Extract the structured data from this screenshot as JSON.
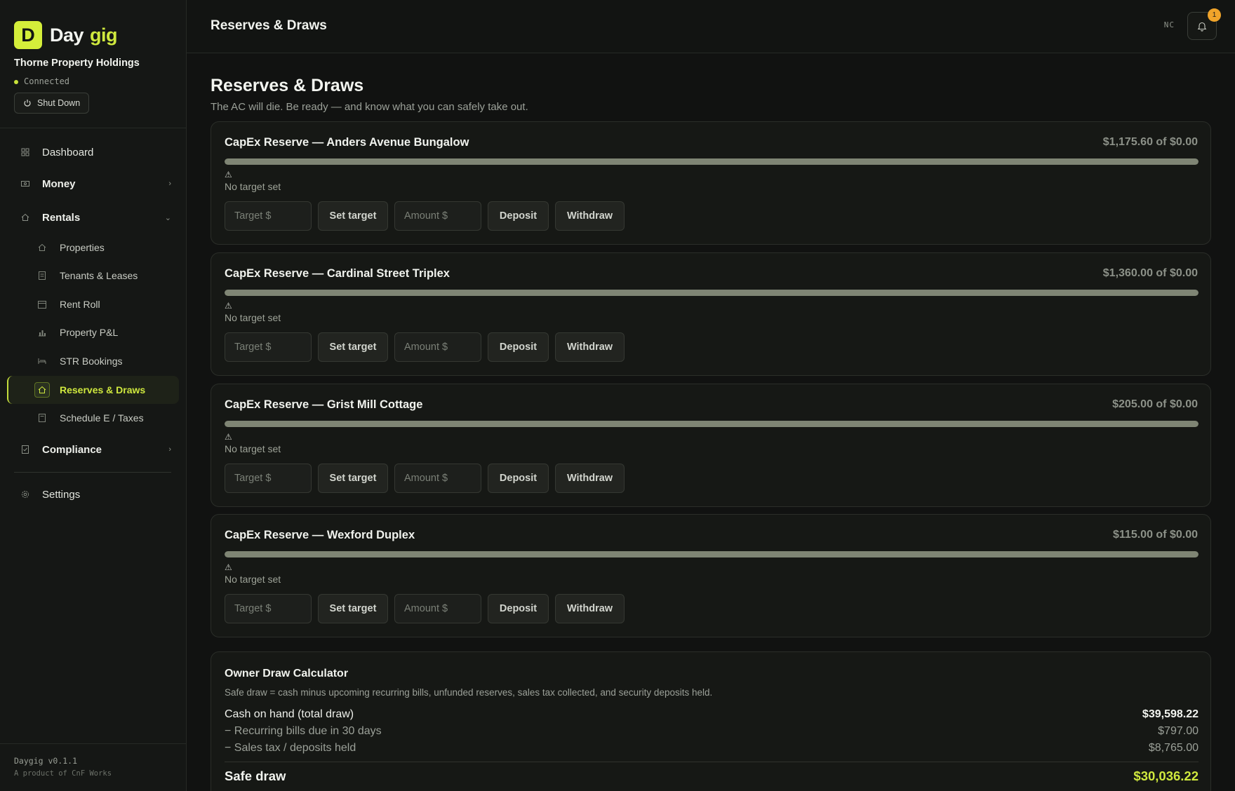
{
  "brand": {
    "logo_letter": "D",
    "name_part1": "Day",
    "name_part2": "gig",
    "accent": "#d4ee3a"
  },
  "org": {
    "name": "Thorne Property Holdings",
    "status": "Connected",
    "shutdown_label": "Shut Down"
  },
  "nav": {
    "dashboard": "Dashboard",
    "money": "Money",
    "rentals": "Rentals",
    "sub": [
      {
        "label": "Properties",
        "icon": "home-icon"
      },
      {
        "label": "Tenants & Leases",
        "icon": "document-icon"
      },
      {
        "label": "Rent Roll",
        "icon": "calendar-icon"
      },
      {
        "label": "Property P&L",
        "icon": "chart-icon"
      },
      {
        "label": "STR Bookings",
        "icon": "bed-icon"
      },
      {
        "label": "Reserves & Draws",
        "icon": "piggy-bank-icon",
        "active": true
      },
      {
        "label": "Schedule E / Taxes",
        "icon": "form-icon"
      }
    ],
    "compliance": "Compliance",
    "settings": "Settings"
  },
  "footer": {
    "version": "Daygig v0.1.1",
    "byline": "A product of CnF Works"
  },
  "header": {
    "title": "Reserves & Draws",
    "initials": "NC",
    "notification_count": "1"
  },
  "page": {
    "title": "Reserves & Draws",
    "subtitle": "The AC will die. Be ready — and know what you can safely take out."
  },
  "reserves": [
    {
      "name": "CapEx Reserve — Anders Avenue Bungalow",
      "amount": "$1,175.60 of $0.00",
      "progress": 1.0,
      "warning_icon": "⚠",
      "status": "No target set",
      "target_placeholder": "Target $",
      "set_target_label": "Set target",
      "amount_placeholder": "Amount $",
      "deposit_label": "Deposit",
      "withdraw_label": "Withdraw"
    },
    {
      "name": "CapEx Reserve — Cardinal Street Triplex",
      "amount": "$1,360.00 of $0.00",
      "progress": 1.0,
      "warning_icon": "⚠",
      "status": "No target set",
      "target_placeholder": "Target $",
      "set_target_label": "Set target",
      "amount_placeholder": "Amount $",
      "deposit_label": "Deposit",
      "withdraw_label": "Withdraw"
    },
    {
      "name": "CapEx Reserve — Grist Mill Cottage",
      "amount": "$205.00 of $0.00",
      "progress": 1.0,
      "warning_icon": "⚠",
      "status": "No target set",
      "target_placeholder": "Target $",
      "set_target_label": "Set target",
      "amount_placeholder": "Amount $",
      "deposit_label": "Deposit",
      "withdraw_label": "Withdraw"
    },
    {
      "name": "CapEx Reserve — Wexford Duplex",
      "amount": "$115.00 of $0.00",
      "progress": 1.0,
      "warning_icon": "⚠",
      "status": "No target set",
      "target_placeholder": "Target $",
      "set_target_label": "Set target",
      "amount_placeholder": "Amount $",
      "deposit_label": "Deposit",
      "withdraw_label": "Withdraw"
    }
  ],
  "calculator": {
    "title": "Owner Draw Calculator",
    "description": "Safe draw = cash minus upcoming recurring bills, unfunded reserves, sales tax collected, and security deposits held.",
    "cash_label": "Cash on hand (total draw)",
    "cash_value": "$39,598.22",
    "bills_label": "− Recurring bills due in 30 days",
    "bills_value": "$797.00",
    "tax_label": "− Sales tax / deposits held",
    "tax_value": "$8,765.00",
    "safe_label": "Safe draw",
    "safe_value": "$30,036.22"
  }
}
